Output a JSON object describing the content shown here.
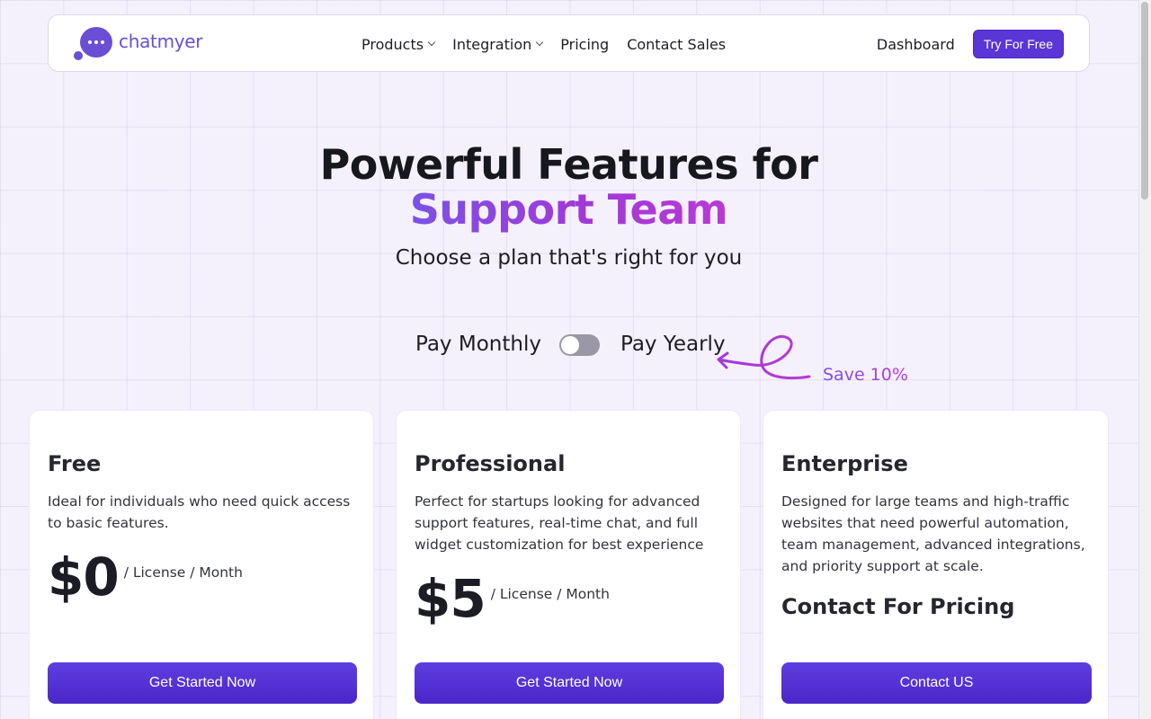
{
  "brand": {
    "name": "chatmyer",
    "color": "#6a4fd6"
  },
  "nav": {
    "links": [
      {
        "label": "Products",
        "has_dropdown": true
      },
      {
        "label": "Integration",
        "has_dropdown": true
      },
      {
        "label": "Pricing",
        "has_dropdown": false
      },
      {
        "label": "Contact Sales",
        "has_dropdown": false
      }
    ],
    "dashboard": "Dashboard",
    "cta": "Try For Free"
  },
  "hero": {
    "title_line1": "Powerful Features for",
    "title_line2": "Support Team",
    "subtitle": "Choose a plan that's right for you"
  },
  "billing": {
    "monthly_label": "Pay Monthly",
    "yearly_label": "Pay Yearly",
    "toggle_state": "monthly",
    "save_label": "Save 10%"
  },
  "plans": [
    {
      "name": "Free",
      "description": "Ideal for individuals who need quick access to basic features.",
      "price": "$0",
      "unit": "/ License / Month",
      "button": "Get Started Now"
    },
    {
      "name": "Professional",
      "description": "Perfect for startups looking for advanced support features, real-time chat, and full widget customization for best experience",
      "price": "$5",
      "unit": "/ License / Month",
      "button": "Get Started Now"
    },
    {
      "name": "Enterprise",
      "description": "Designed for large teams and high-traffic websites that need powerful automation, team management, advanced integrations, and priority support at scale.",
      "price_text": "Contact For Pricing",
      "button": "Contact US"
    }
  ],
  "colors": {
    "accent": "#5b36d6",
    "gradient_start": "#7b52e6",
    "gradient_end": "#b83ad3",
    "background": "#f4f1fd"
  }
}
